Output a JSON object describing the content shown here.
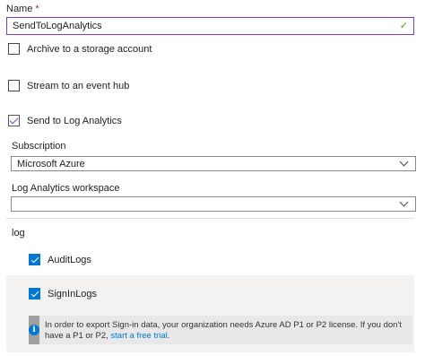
{
  "name_field": {
    "label": "Name",
    "required_marker": "*",
    "value": "SendToLogAnalytics"
  },
  "destinations": [
    {
      "label": "Archive to a storage account",
      "checked": false
    },
    {
      "label": "Stream to an event hub",
      "checked": false
    },
    {
      "label": "Send to Log Analytics",
      "checked": true
    }
  ],
  "subscription": {
    "label": "Subscription",
    "value": "Microsoft Azure"
  },
  "workspace": {
    "label": "Log Analytics workspace",
    "value": ""
  },
  "log_section": {
    "title": "log",
    "items": [
      {
        "label": "AuditLogs",
        "checked": true
      },
      {
        "label": "SignInLogs",
        "checked": true
      }
    ]
  },
  "info": {
    "text": "In order to export Sign-in data, your organization needs Azure AD P1 or P2 license. If you don't have a P1 or P2, ",
    "link_text": "start a free trial",
    "suffix": "."
  },
  "colors": {
    "accent": "#8a3bc6",
    "checkbox_blue": "#0078d4",
    "link": "#0078d4",
    "valid_check": "#57a300"
  }
}
